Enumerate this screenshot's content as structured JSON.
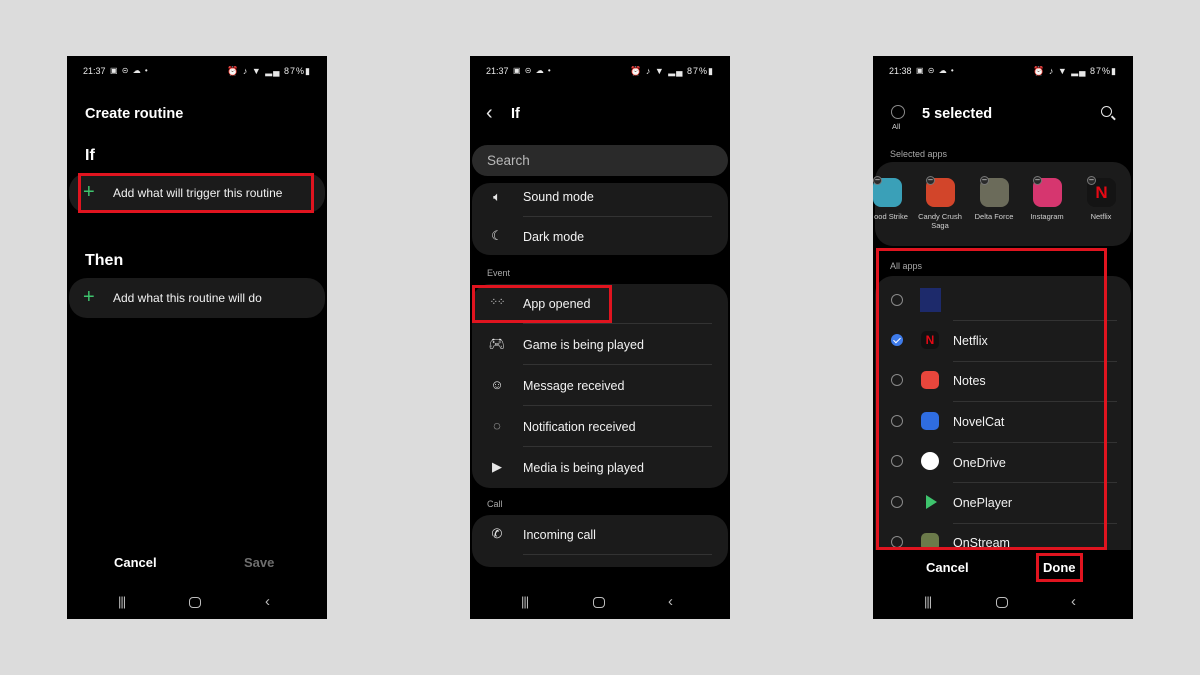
{
  "screen1": {
    "status": {
      "time": "21:37",
      "icons": "▣ ⊝ ☁ •",
      "right": "⏰ ♪ ▼ ▂▄ 87%▮"
    },
    "title": "Create routine",
    "if_heading": "If",
    "if_add_label": "Add what will trigger this routine",
    "then_heading": "Then",
    "then_add_label": "Add what this routine will do",
    "cancel_label": "Cancel",
    "save_label": "Save"
  },
  "screen2": {
    "status": {
      "time": "21:37",
      "icons": "▣ ⊝ ☁ •",
      "right": "⏰ ♪ ▼ ▂▄ 87%▮"
    },
    "title": "If",
    "search_placeholder": "Search",
    "items_top": [
      {
        "label": "Sound mode",
        "icon": "speaker-icon"
      },
      {
        "label": "Dark mode",
        "icon": "moon-icon"
      }
    ],
    "event_section": "Event",
    "event_items": [
      {
        "label": "App opened",
        "icon": "apps-grid-icon"
      },
      {
        "label": "Game is being played",
        "icon": "gamepad-icon"
      },
      {
        "label": "Message received",
        "icon": "message-icon"
      },
      {
        "label": "Notification received",
        "icon": "notification-icon"
      },
      {
        "label": "Media is being played",
        "icon": "play-icon"
      }
    ],
    "call_section": "Call",
    "call_items": [
      {
        "label": "Incoming call",
        "icon": "incoming-call-icon"
      }
    ]
  },
  "screen3": {
    "status": {
      "time": "21:38",
      "icons": "▣ ⊝ ☁ •",
      "right": "⏰ ♪ ▼ ▂▄ 87%▮"
    },
    "all_label": "All",
    "selected_count": "5 selected",
    "selected_apps_label": "Selected apps",
    "selected_apps": [
      {
        "name": "ood Strike",
        "color": "#3aa0b8"
      },
      {
        "name": "Candy Crush Saga",
        "color": "#d2452a"
      },
      {
        "name": "Delta Force",
        "color": "#6b6b5a"
      },
      {
        "name": "Instagram",
        "color": "#d6366f"
      },
      {
        "name": "Netflix",
        "color": "#141414"
      }
    ],
    "all_apps_label": "All apps",
    "apps": [
      {
        "name": "",
        "checked": false,
        "color": "#1d2a6b"
      },
      {
        "name": "Netflix",
        "checked": true,
        "color": "#111111"
      },
      {
        "name": "Notes",
        "checked": false,
        "color": "#e8463c"
      },
      {
        "name": "NovelCat",
        "checked": false,
        "color": "#2f6de0"
      },
      {
        "name": "OneDrive",
        "checked": false,
        "color": "#ffffff"
      },
      {
        "name": "OnePlayer",
        "checked": false,
        "color": "#1d1d1d"
      },
      {
        "name": "OnStream",
        "checked": false,
        "color": "#6b7a4a"
      }
    ],
    "cancel_label": "Cancel",
    "done_label": "Done"
  },
  "colors": {
    "highlight": "#e0141f",
    "accent_green": "#3ec46d",
    "check_blue": "#3e7bea"
  }
}
